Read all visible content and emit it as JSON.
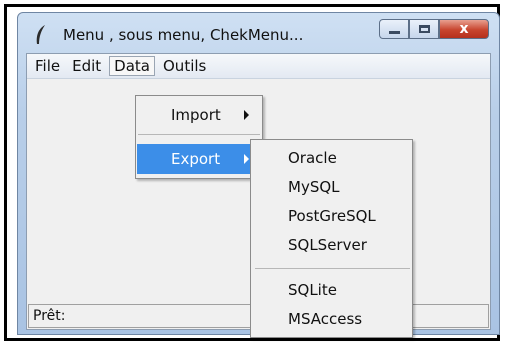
{
  "window": {
    "title": "Menu , sous menu, ChekMenu...",
    "close_glyph": "x"
  },
  "menubar": {
    "items": [
      "File",
      "Edit",
      "Data",
      "Outils"
    ],
    "active": "Data"
  },
  "data_menu": {
    "items": [
      {
        "label": "Import",
        "has_submenu": true
      },
      {
        "label": "Export",
        "has_submenu": true,
        "highlighted": true
      }
    ]
  },
  "export_submenu": {
    "group1": [
      "Oracle",
      "MySQL",
      "PostGreSQL",
      "SQLServer"
    ],
    "group2": [
      "SQLite",
      "MSAccess"
    ]
  },
  "status": {
    "text": "Prêt:"
  },
  "colors": {
    "highlight": "#3c8ee8",
    "close_button": "#c8452e"
  }
}
